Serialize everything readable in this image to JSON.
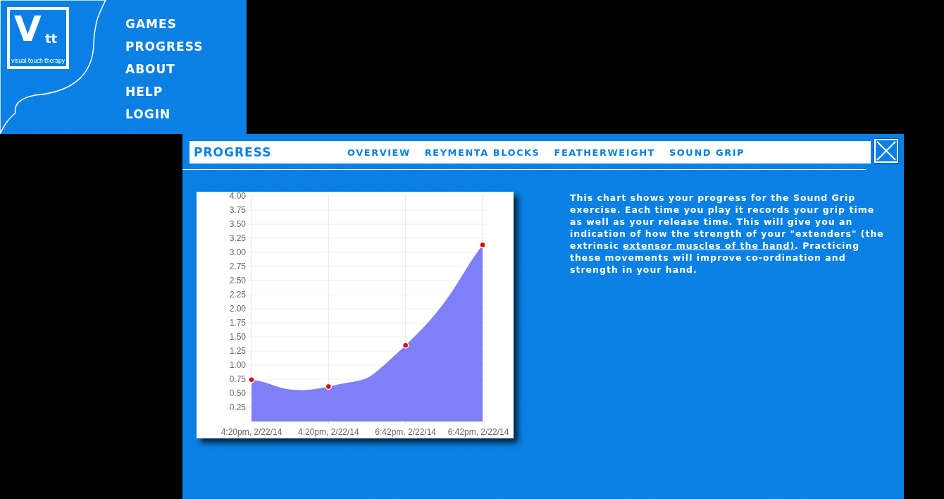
{
  "logo": {
    "mark": "V",
    "mark_small": "tt",
    "tagline": "visual touch therapy"
  },
  "menu": [
    "GAMES",
    "PROGRESS",
    "ABOUT",
    "HELP",
    "LOGIN"
  ],
  "panel": {
    "title": "PROGRESS",
    "tabs": [
      "OVERVIEW",
      "REYMENTA BLOCKS",
      "FEATHERWEIGHT",
      "SOUND GRIP"
    ]
  },
  "chart_data": {
    "type": "area",
    "categories": [
      "4:20pm, 2/22/14",
      "4:20pm, 2/22/14",
      "6:42pm, 2/22/14",
      "6:42pm, 2/22/14"
    ],
    "series": [
      {
        "color": "#7f7ff8",
        "values": [
          0.74,
          0.62,
          1.35,
          3.13
        ]
      }
    ],
    "grid": true,
    "ylim": [
      0,
      4
    ],
    "yticks": [
      {
        "value": 0.25,
        "label": "0.25"
      },
      {
        "value": 0.5,
        "label": "0.50"
      },
      {
        "value": 0.75,
        "label": "0.75"
      },
      {
        "value": 1,
        "label": "1.00"
      },
      {
        "value": 1.25,
        "label": "1.25"
      },
      {
        "value": 1.5,
        "label": "1.50"
      },
      {
        "value": 1.75,
        "label": "1.75"
      },
      {
        "value": 2,
        "label": "2.00"
      },
      {
        "value": 2.25,
        "label": "2.25"
      },
      {
        "value": 2.5,
        "label": "2.50"
      },
      {
        "value": 2.75,
        "label": "2.75"
      },
      {
        "value": 3,
        "label": "3.00"
      },
      {
        "value": 3.25,
        "label": "3.25"
      },
      {
        "value": 3.5,
        "label": "3.50"
      },
      {
        "value": 3.75,
        "label": "3.75"
      },
      {
        "value": 4,
        "label": "4.00"
      }
    ]
  },
  "description": {
    "before": "This chart shows your progress for the Sound Grip exercise. Each time you play it records your grip time as well as your release time. This will give you an indication of how the strength of your \"extenders\" (the extrinsic",
    "link": "extensor muscles of the hand)",
    "after": ". Practicing these movements will improve co-ordination and strength in your hand."
  }
}
